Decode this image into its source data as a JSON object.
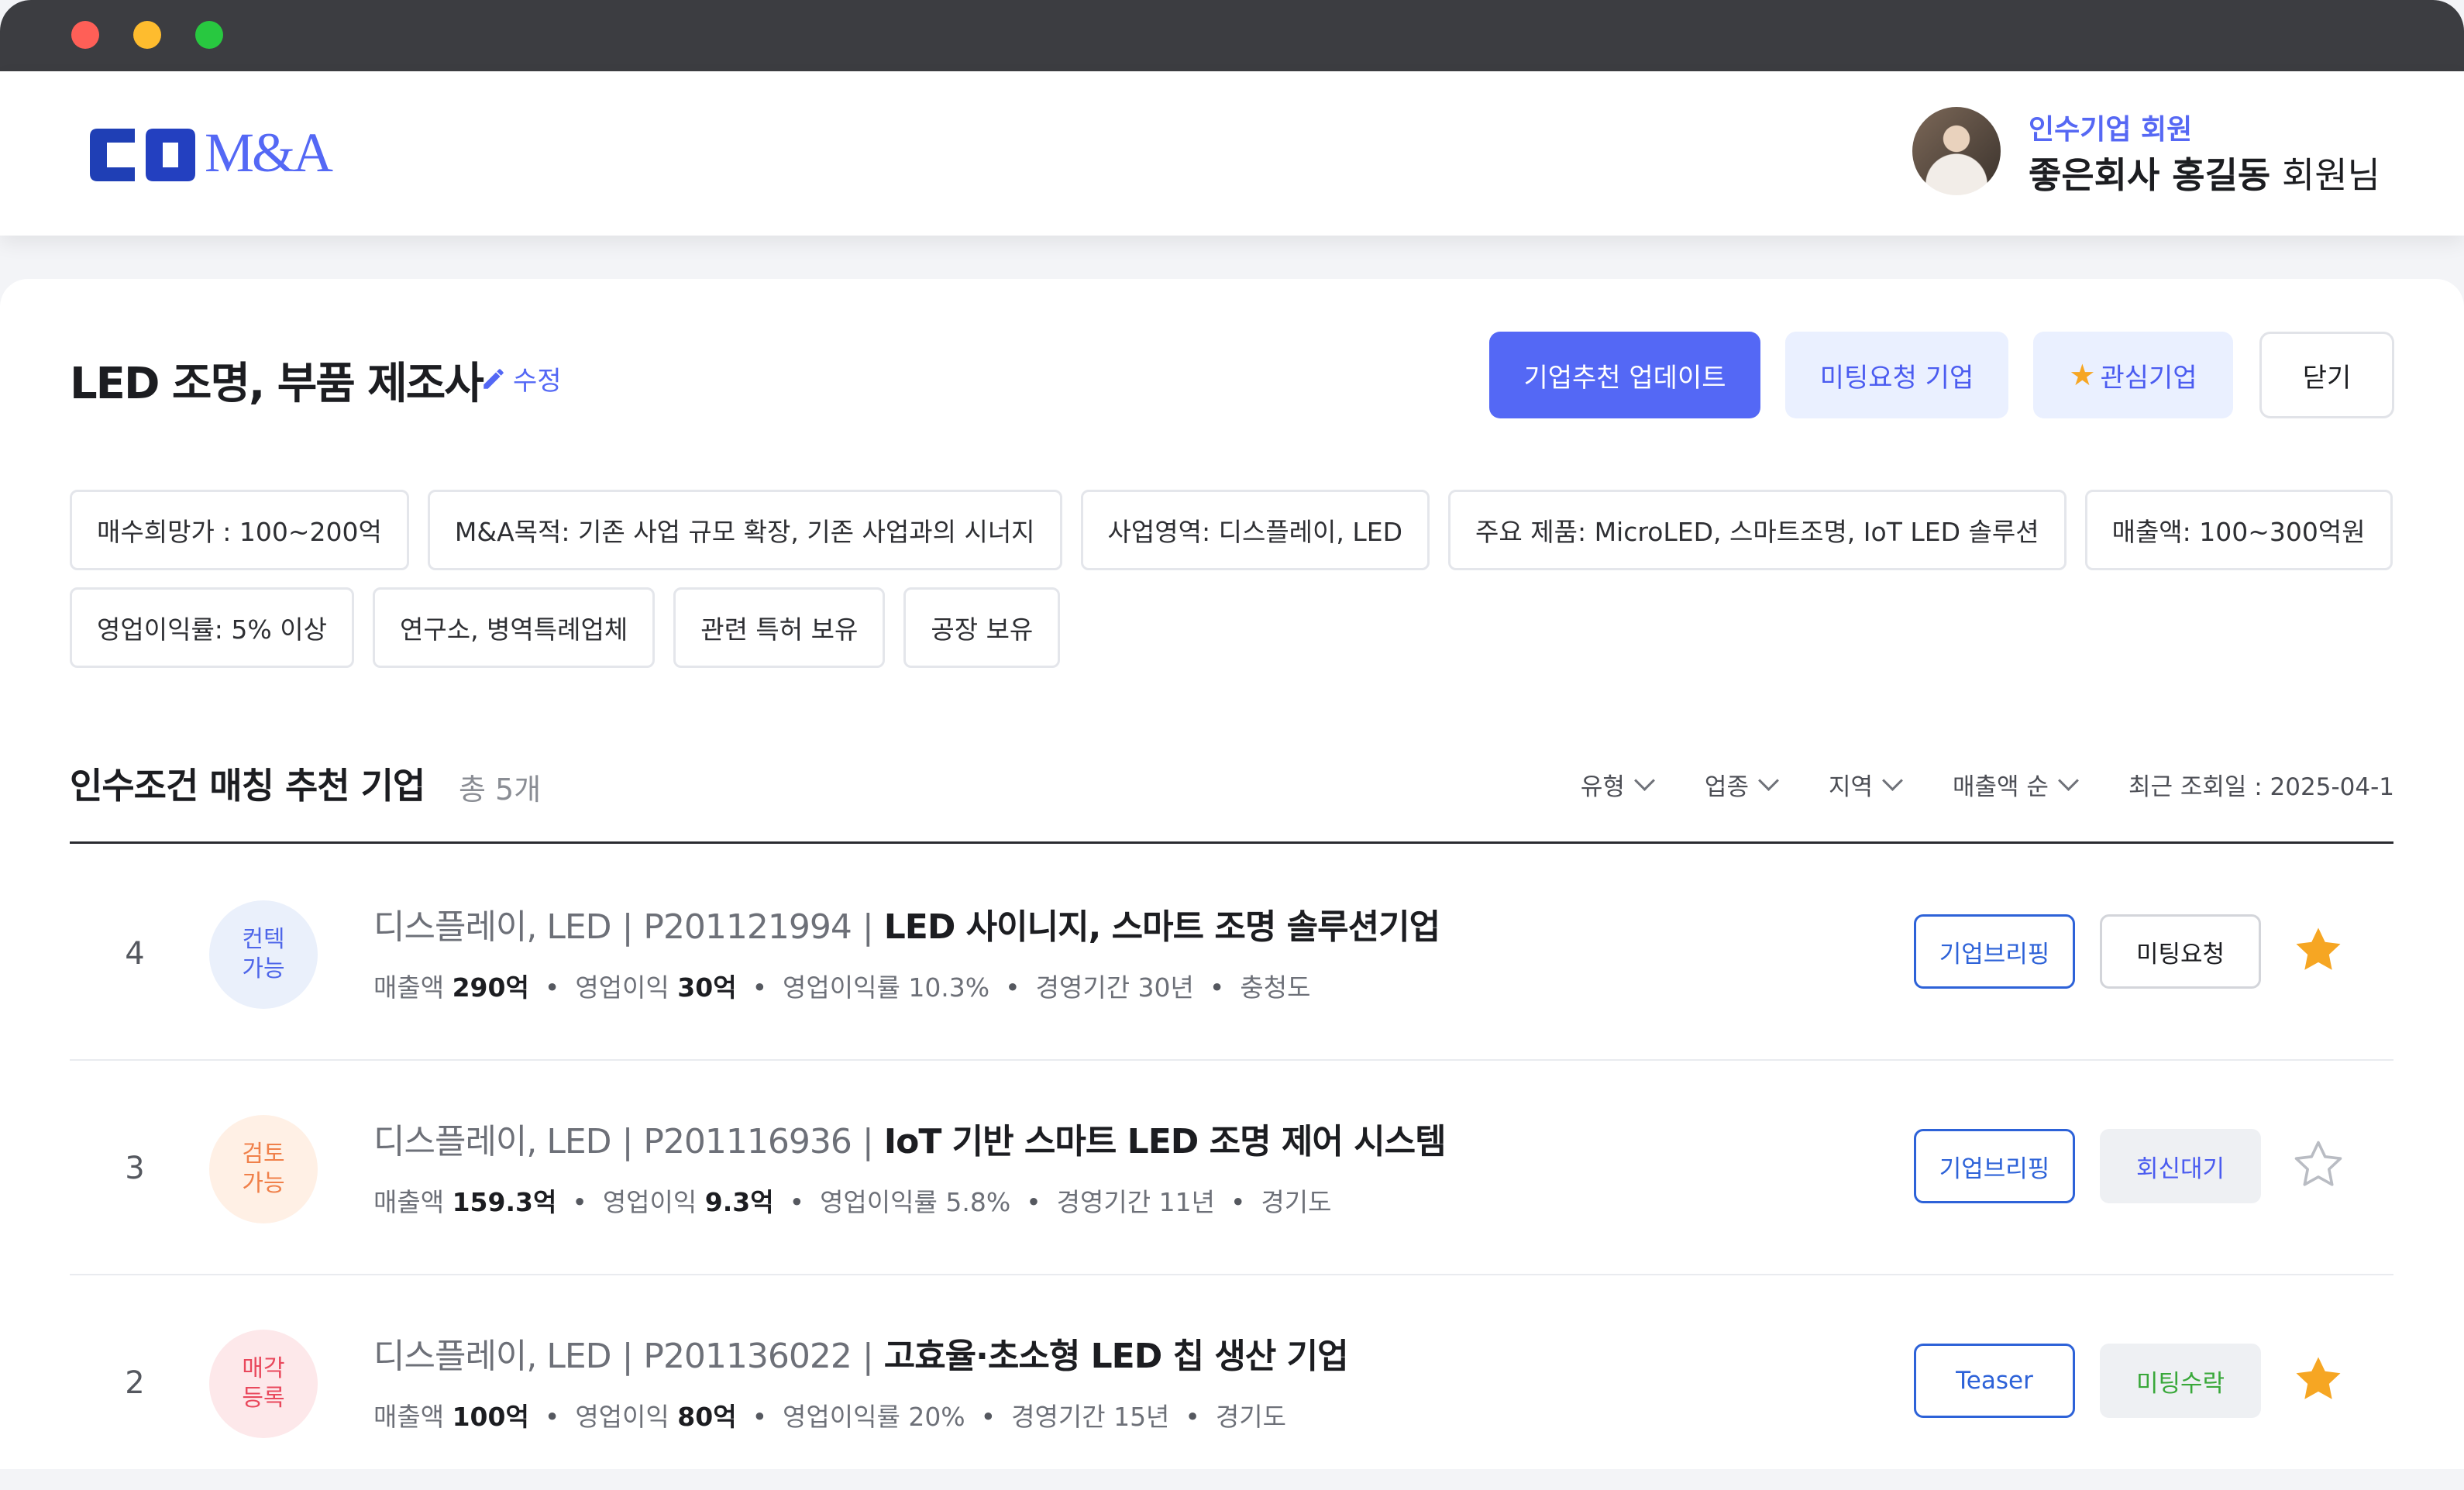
{
  "header": {
    "logo_text": "CO M&A",
    "member_type": "인수기업 회원",
    "member_company": "좋은회사 홍길동",
    "member_suffix": "회원님"
  },
  "page": {
    "title": "LED 조명, 부품 제조사",
    "edit_label": "수정",
    "buttons": {
      "update": "기업추천 업데이트",
      "meeting_requests": "미팅요청 기업",
      "favorites": "관심기업",
      "close": "닫기"
    },
    "tags": [
      "매수희망가 : 100~200억",
      "M&A목적:  기존 사업 규모 확장, 기존 사업과의 시너지",
      "사업영역: 디스플레이, LED",
      "주요 제품: MicroLED, 스마트조명, IoT LED 솔루션",
      "매출액: 100~300억원",
      "영업이익률: 5% 이상",
      "연구소, 병역특례업체",
      "관련 특허 보유",
      "공장 보유"
    ]
  },
  "list": {
    "title": "인수조건 매칭 추천 기업",
    "count": "총 5개",
    "filters": [
      "유형",
      "업종",
      "지역",
      "매출액 순"
    ],
    "last_viewed": "최근 조회일 : 2025-04-1",
    "rows": [
      {
        "rank": "4",
        "status": "컨텍\n가능",
        "status_color": "#4e66e9",
        "category": "디스플레이, LED",
        "code": "P201121994",
        "name": "LED 사이니지, 스마트 조명 솔루션기업",
        "sales_label": "매출액",
        "sales": "290억",
        "op_label": "영업이익",
        "op": "30억",
        "margin": "영업이익률 10.3%",
        "years": "경영기간 30년",
        "region": "충청도",
        "btn1": "기업브리핑",
        "btn2": "미팅요청",
        "favorite": true
      },
      {
        "rank": "3",
        "status": "검토\n가능",
        "status_color": "#f0804a",
        "category": "디스플레이, LED",
        "code": "P201116936",
        "name": "IoT 기반 스마트 LED 조명 제어 시스템",
        "sales_label": "매출액",
        "sales": "159.3억",
        "op_label": "영업이익",
        "op": "9.3억",
        "margin": "영업이익률 5.8%",
        "years": "경영기간 11년",
        "region": "경기도",
        "btn1": "기업브리핑",
        "btn2": "회신대기",
        "favorite": false
      },
      {
        "rank": "2",
        "status": "매각\n등록",
        "status_color": "#e9485c",
        "category": "디스플레이, LED",
        "code": "P201136022",
        "name": "고효율·초소형 LED 칩 생산 기업",
        "sales_label": "매출액",
        "sales": "100억",
        "op_label": "영업이익",
        "op": "80억",
        "margin": "영업이익률 20%",
        "years": "경영기간 15년",
        "region": "경기도",
        "btn1": "Teaser",
        "btn2": "미팅수락",
        "favorite": true
      }
    ]
  },
  "colors": {
    "accent": "#5468f5",
    "star_active": "#f6a623",
    "star_inactive": "#b9bcc3"
  }
}
